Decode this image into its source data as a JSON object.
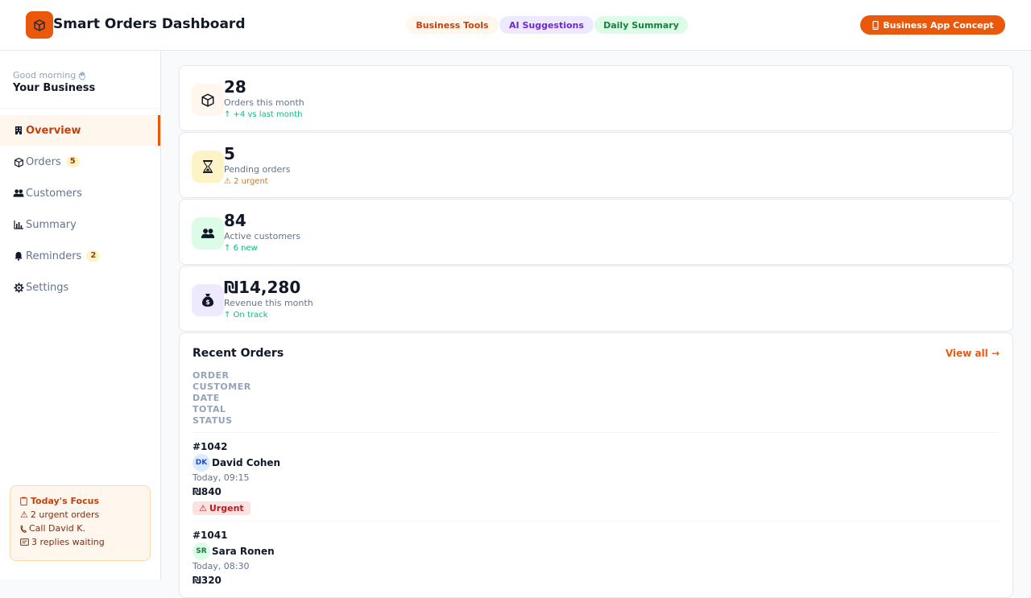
{
  "header": {
    "title": "Smart Orders Dashboard",
    "pills": [
      "Business Tools",
      "AI Suggestions",
      "Daily Summary"
    ],
    "concept_button": "Business App Concept"
  },
  "sidebar": {
    "greeting": "Good morning",
    "business_name": "Your Business",
    "items": [
      {
        "label": "Overview",
        "icon": "building-icon",
        "active": true
      },
      {
        "label": "Orders",
        "icon": "package-icon",
        "badge": "5"
      },
      {
        "label": "Customers",
        "icon": "people-icon"
      },
      {
        "label": "Summary",
        "icon": "bar-chart-icon"
      },
      {
        "label": "Reminders",
        "icon": "bell-icon",
        "badge": "2"
      },
      {
        "label": "Settings",
        "icon": "gear-icon"
      }
    ],
    "focus": {
      "title": "Today's Focus",
      "lines": [
        "2 urgent orders",
        "Call David K.",
        "3 replies waiting"
      ]
    }
  },
  "stats": [
    {
      "value": "28",
      "label": "Orders this month",
      "trend": "↑ +4 vs last month",
      "icon": "package-icon",
      "color": "#10b981"
    },
    {
      "value": "5",
      "label": "Pending orders",
      "trend": "⚠ 2 urgent",
      "icon": "hourglass-icon",
      "color": "#d97706"
    },
    {
      "value": "84",
      "label": "Active customers",
      "trend": "↑ 6 new",
      "icon": "people-icon",
      "color": "#10b981"
    },
    {
      "value": "₪14,280",
      "label": "Revenue this month",
      "trend": "↑ On track",
      "icon": "money-bag-icon",
      "color": "#10b981"
    }
  ],
  "recent_orders": {
    "title": "Recent Orders",
    "view_all": "View all →",
    "columns": [
      "ORDER",
      "CUSTOMER",
      "DATE",
      "TOTAL",
      "STATUS"
    ],
    "rows": [
      {
        "id": "#1042",
        "initials": "DK",
        "customer": "David Cohen",
        "date": "Today, 09:15",
        "total": "₪840",
        "status": "Urgent"
      },
      {
        "id": "#1041",
        "initials": "SR",
        "customer": "Sara Ronen",
        "date": "Today, 08:30",
        "total": "₪320",
        "status": ""
      }
    ]
  },
  "colors": {
    "accent": "#ea580c",
    "success": "#10b981",
    "warning": "#d97706",
    "danger": "#b91c1c"
  }
}
